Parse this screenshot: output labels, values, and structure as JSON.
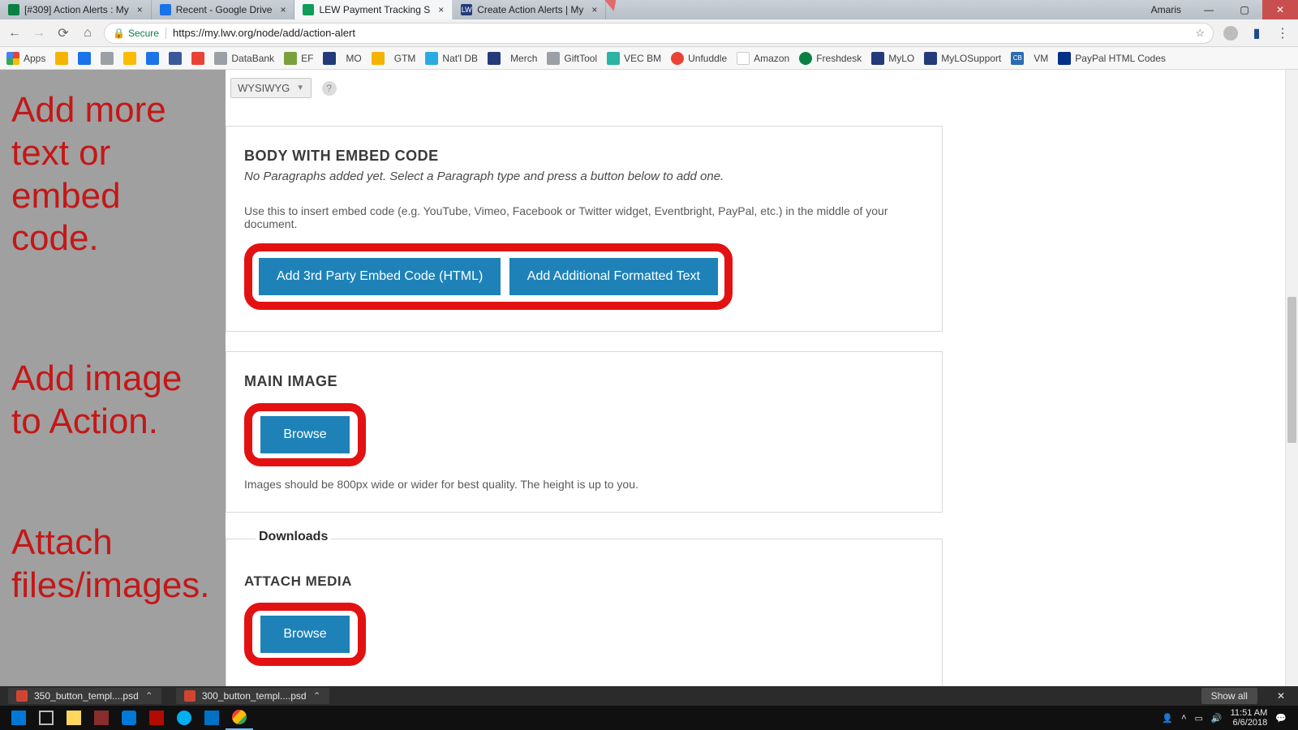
{
  "window": {
    "user": "Amaris"
  },
  "tabs": [
    {
      "title": "[#309] Action Alerts : My",
      "color": "c-green"
    },
    {
      "title": "Recent - Google Drive",
      "color": "c-blue"
    },
    {
      "title": "LEW Payment Tracking S",
      "color": "c-sheets",
      "active": true
    },
    {
      "title": "Create Action Alerts | My",
      "color": "c-lwv"
    }
  ],
  "address": {
    "secure_label": "Secure",
    "url": "https://my.lwv.org/node/add/action-alert"
  },
  "bookmarks": {
    "apps": "Apps",
    "items": [
      "DataBank",
      "EF",
      "MO",
      "GTM",
      "Nat'l DB",
      "Merch",
      "GiftTool",
      "VEC BM",
      "Unfuddle",
      "Amazon",
      "Freshdesk",
      "MyLO",
      "MyLOSupport",
      "VM",
      "PayPal HTML Codes"
    ]
  },
  "annotations": {
    "a1": "Add more text or embed code.",
    "a2": "Add image to Action.",
    "a3": "Attach files/images."
  },
  "form": {
    "wysiwyg_label": "WYSIWYG",
    "body_embed": {
      "heading": "BODY WITH EMBED CODE",
      "sub": "No Paragraphs added yet. Select a Paragraph type and press a button below to add one.",
      "hint": "Use this to insert embed code (e.g. YouTube, Vimeo, Facebook or Twitter widget, Eventbright, PayPal, etc.) in the middle of your document.",
      "btn1": "Add 3rd Party Embed Code (HTML)",
      "btn2": "Add Additional Formatted Text"
    },
    "main_image": {
      "heading": "MAIN IMAGE",
      "browse": "Browse",
      "hint": "Images should be 800px wide or wider for best quality. The height is up to you."
    },
    "downloads": {
      "legend": "Downloads",
      "heading": "ATTACH MEDIA",
      "browse": "Browse"
    }
  },
  "download_shelf": {
    "items": [
      "350_button_templ....psd",
      "300_button_templ....psd"
    ],
    "show_all": "Show all"
  },
  "clock": {
    "time": "11:51 AM",
    "date": "6/6/2018"
  }
}
